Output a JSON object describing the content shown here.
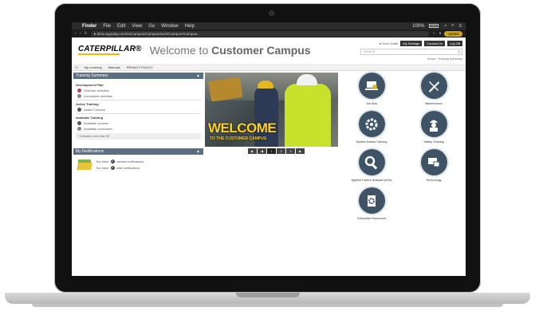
{
  "macos": {
    "apple": "",
    "app": "Finder",
    "menu": [
      "File",
      "Edit",
      "View",
      "Go",
      "Window",
      "Help"
    ],
    "battery": "100%"
  },
  "browser": {
    "url": "●  dma.sugoday.com/en/campus/Campus/tus/s/Campus?Campus... ",
    "update_label": "Update"
  },
  "site": {
    "logo": "CATERPILLAR®",
    "welcome_prefix": "Welcome to ",
    "welcome_bold": "Customer Campus",
    "user": "●  John Smith",
    "links": [
      "My Settings",
      "Contact Us",
      "Log Off"
    ],
    "search_placeholder": "Search",
    "breadcrumb_right": "Home / Training Summary"
  },
  "nav": {
    "items": [
      "My Learning",
      "Manuals",
      "PRIVACY POLICY"
    ]
  },
  "training_summary": {
    "title": "Training Summary",
    "sections": [
      {
        "heading": "Development Plan",
        "rows": [
          "Overdue activities",
          "Incomplete activities"
        ]
      },
      {
        "heading": "Active Training",
        "rows": [
          "Active Courses"
        ]
      },
      {
        "heading": "Available Training",
        "rows": [
          "Available courses",
          "Available curriculum"
        ]
      }
    ],
    "note": "* Indicates more than 99"
  },
  "notifications": {
    "title": "My Notifications",
    "lines": [
      {
        "pre": "You have",
        "count": "0",
        "post": "unread notifications"
      },
      {
        "pre": "You have",
        "count": "0",
        "post": "total notifications"
      }
    ]
  },
  "hero": {
    "headline": "WELCOME",
    "subline": "TO THE CUSTOMER CAMPUS",
    "controls": [
      "▶",
      "◀",
      "1",
      "2",
      "3",
      "▶"
    ]
  },
  "tiles": [
    {
      "label": "Job Aids",
      "icon": "laptop-icon"
    },
    {
      "label": "Maintenance",
      "icon": "wrench-icon"
    },
    {
      "label": "System Based Training",
      "icon": "gear-icon"
    },
    {
      "label": "Safety Training",
      "icon": "worker-icon"
    },
    {
      "label": "Applied Failure Analysis (AFA)",
      "icon": "magnifier-icon"
    },
    {
      "label": "Technology",
      "icon": "devices-icon"
    },
    {
      "label": "Caterpillar Resources",
      "icon": "document-gear-icon"
    }
  ],
  "colors": {
    "panel_header": "#5c6f82",
    "tile_circle": "#3e5466",
    "brand_yellow": "#f5b800"
  }
}
